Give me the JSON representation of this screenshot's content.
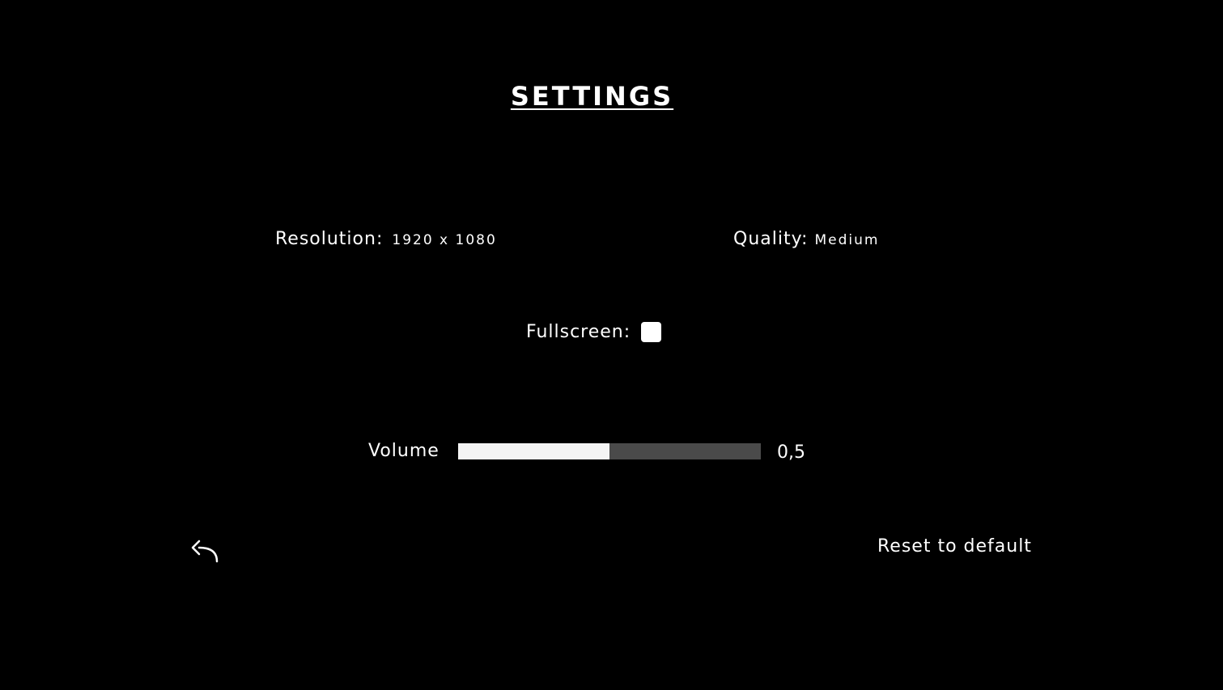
{
  "title": "SETTINGS",
  "resolution": {
    "label": "Resolution:",
    "value": "1920 x 1080"
  },
  "quality": {
    "label": "Quality:",
    "value": "Medium"
  },
  "fullscreen": {
    "label": "Fullscreen:",
    "checked": false
  },
  "volume": {
    "label": "Volume",
    "level": 0.5,
    "display": "0,5"
  },
  "reset_label": "Reset to default",
  "icons": {
    "back": "back-arrow-icon"
  },
  "colors": {
    "background": "#000000",
    "text": "#ffffff",
    "slider_fill": "#f4f4f4",
    "slider_track": "#4a4a4a"
  }
}
